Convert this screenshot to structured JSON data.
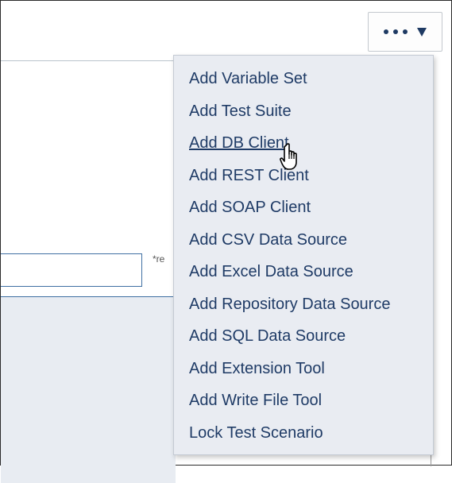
{
  "more_button": {
    "icon": "ellipsis-icon",
    "caret_icon": "caret-down-icon",
    "label": "",
    "color": "#1e3a63"
  },
  "form": {
    "input_value": "",
    "required_note": "*re"
  },
  "menu": {
    "background": "#e9ecf2",
    "text_color": "#1f3b66",
    "hovered_item": "Add DB Client",
    "items": [
      {
        "label": "Add Variable Set"
      },
      {
        "label": "Add Test Suite"
      },
      {
        "label": "Add DB Client"
      },
      {
        "label": "Add REST Client"
      },
      {
        "label": "Add SOAP Client"
      },
      {
        "label": "Add CSV Data Source"
      },
      {
        "label": "Add Excel Data Source"
      },
      {
        "label": "Add Repository Data Source"
      },
      {
        "label": "Add SQL Data Source"
      },
      {
        "label": "Add Extension Tool"
      },
      {
        "label": "Add Write File Tool"
      },
      {
        "label": "Lock Test Scenario"
      }
    ]
  },
  "cursor": {
    "icon": "hand-pointer-icon"
  }
}
